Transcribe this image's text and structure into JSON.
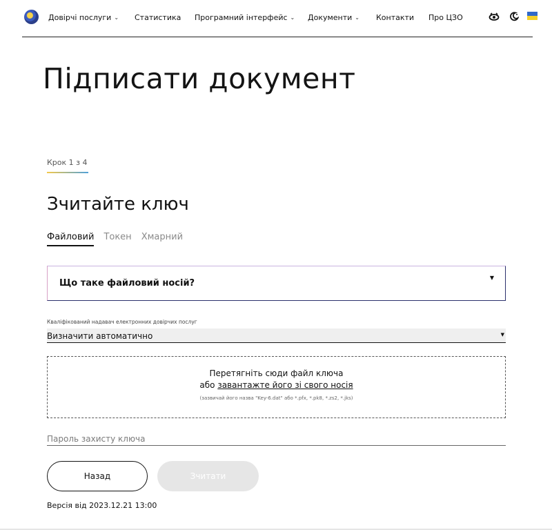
{
  "nav": {
    "items": [
      {
        "label": "Довірчі послуги",
        "has_dropdown": true
      },
      {
        "label": "Статистика",
        "has_dropdown": false
      },
      {
        "label": "Програмний інтерфейс",
        "has_dropdown": true
      },
      {
        "label": "Документи",
        "has_dropdown": true
      },
      {
        "label": "Контакти",
        "has_dropdown": false
      },
      {
        "label": "Про ЦЗО",
        "has_dropdown": false
      }
    ],
    "chevron": "⌄",
    "icons": [
      "low-vision-icon",
      "dark-mode-icon",
      "ukraine-flag-icon"
    ]
  },
  "page": {
    "title": "Підписати документ"
  },
  "step": {
    "label": "Крок 1 з 4"
  },
  "section": {
    "title": "Зчитайте ключ"
  },
  "tabs": [
    {
      "label": "Файловий",
      "active": true
    },
    {
      "label": "Токен",
      "active": false
    },
    {
      "label": "Хмарний",
      "active": false
    }
  ],
  "accordion": {
    "label": "Що таке файловий носій?",
    "arrow": "▼"
  },
  "provider": {
    "label": "Кваліфікований надавач електронних довірчих послуг",
    "value": "Визначити автоматично",
    "arrow": "▼"
  },
  "dropzone": {
    "line1": "Перетягніть сюди файл ключа",
    "line2_prefix": "або ",
    "line2_link": "завантажте його зі свого носія",
    "hint": "(зазвичай його назва \"Key-6.dat\" або *.pfx, *.pk8, *.zs2, *.jks)"
  },
  "password": {
    "placeholder": "Пароль захисту ключа",
    "value": ""
  },
  "buttons": {
    "back": "Назад",
    "read": "Зчитати"
  },
  "version": "Версія від 2023.12.21 13:00",
  "colors": {
    "accent_border": "#2a2f6b",
    "flag_blue": "#3169c9",
    "flag_yellow": "#f5d02a",
    "disabled_button": "#e6e6e6"
  }
}
